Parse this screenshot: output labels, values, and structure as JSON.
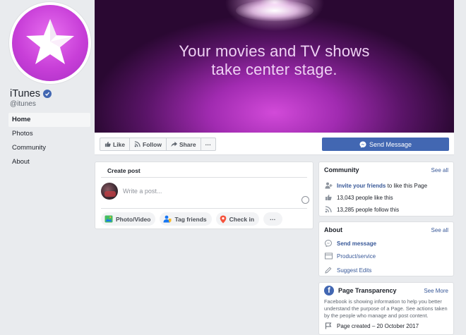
{
  "page": {
    "name": "iTunes",
    "handle": "@itunes"
  },
  "nav": {
    "items": [
      {
        "label": "Home",
        "active": true
      },
      {
        "label": "Photos"
      },
      {
        "label": "Community"
      },
      {
        "label": "About"
      }
    ]
  },
  "cover": {
    "line1": "Your movies and TV shows",
    "line2": "take center stage."
  },
  "actions": {
    "like": "Like",
    "follow": "Follow",
    "share": "Share",
    "more": "···",
    "send_message": "Send Message"
  },
  "create_post": {
    "title": "Create post",
    "placeholder": "Write a post...",
    "photo_video": "Photo/Video",
    "tag_friends": "Tag friends",
    "check_in": "Check in",
    "more": "···"
  },
  "community": {
    "title": "Community",
    "see_all": "See all",
    "invite_link": "Invite your friends",
    "invite_rest": " to like this Page",
    "likes": "13,043 people like this",
    "follows": "13,285 people follow this"
  },
  "about": {
    "title": "About",
    "see_all": "See all",
    "send_message": "Send message",
    "category": "Product/service",
    "suggest": "Suggest Edits"
  },
  "transparency": {
    "title": "Page Transparency",
    "see_more": "See More",
    "description": "Facebook is showing information to help you better understand the purpose of a Page. See actions taken by the people who manage and post content.",
    "created": "Page created – 20 October 2017"
  },
  "colors": {
    "brand_blue": "#4267b2",
    "link_blue": "#385898",
    "background": "#e9ebee",
    "avatar_pink": "#c83fd8"
  }
}
